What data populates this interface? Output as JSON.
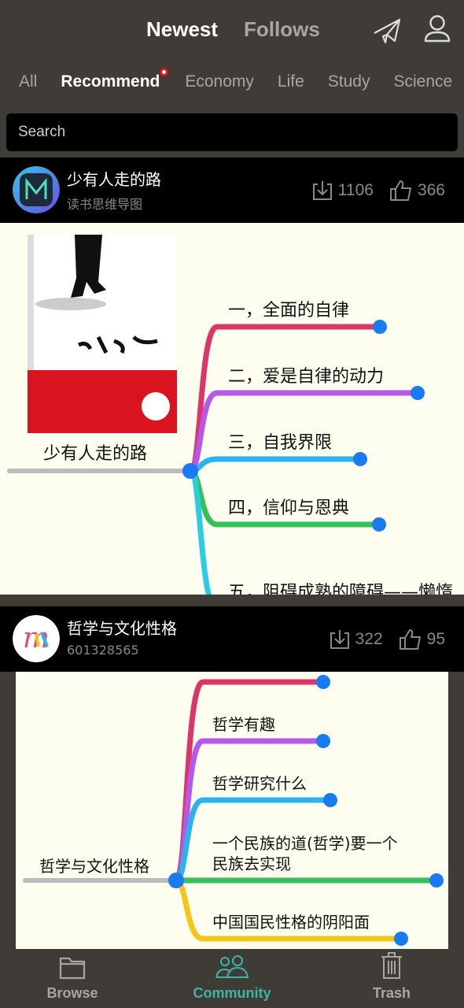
{
  "header": {
    "tabs": [
      {
        "label": "Newest",
        "active": true
      },
      {
        "label": "Follows",
        "active": false
      }
    ],
    "icons": [
      "send-icon",
      "user-icon"
    ]
  },
  "categories": [
    {
      "label": "All"
    },
    {
      "label": "Recommend",
      "active": true,
      "badge": true
    },
    {
      "label": "Economy"
    },
    {
      "label": "Life"
    },
    {
      "label": "Study"
    },
    {
      "label": "Science"
    }
  ],
  "search": {
    "placeholder": "Search"
  },
  "cards": [
    {
      "title": "少有人走的路",
      "author": "读书思维导图",
      "downloads": "1106",
      "likes": "366",
      "map": {
        "root": "少有人走的路",
        "branches": [
          {
            "label": "一，全面的自律",
            "color": "#dc3567"
          },
          {
            "label": "二，爱是自律的动力",
            "color": "#b659e8"
          },
          {
            "label": "三，自我界限",
            "color": "#2bb4ec"
          },
          {
            "label": "四，信仰与恩典",
            "color": "#36c05a"
          },
          {
            "label": "五，阻碍成熟的障碍——懒惰",
            "color": "#2ccde3"
          }
        ]
      }
    },
    {
      "title": "哲学与文化性格",
      "author": "601328565",
      "downloads": "322",
      "likes": "95",
      "map": {
        "root": "哲学与文化性格",
        "branches": [
          {
            "label": "",
            "color": "#dc3567"
          },
          {
            "label": "哲学有趣",
            "color": "#b659e8"
          },
          {
            "label": "哲学研究什么",
            "color": "#2bb4ec"
          },
          {
            "label": "一个民族的道(哲学)要一个民族去实现",
            "color": "#36c05a"
          },
          {
            "label": "中国国民性格的阴阳面",
            "color": "#f5c518"
          }
        ]
      }
    }
  ],
  "bottom_nav": [
    {
      "label": "Browse",
      "icon": "folder-icon"
    },
    {
      "label": "Community",
      "icon": "people-icon",
      "active": true
    },
    {
      "label": "Trash",
      "icon": "trash-icon"
    }
  ],
  "colors": {
    "accent": "#3fb5a3",
    "node": "#1a7bf0",
    "background": "#3f3b37"
  }
}
